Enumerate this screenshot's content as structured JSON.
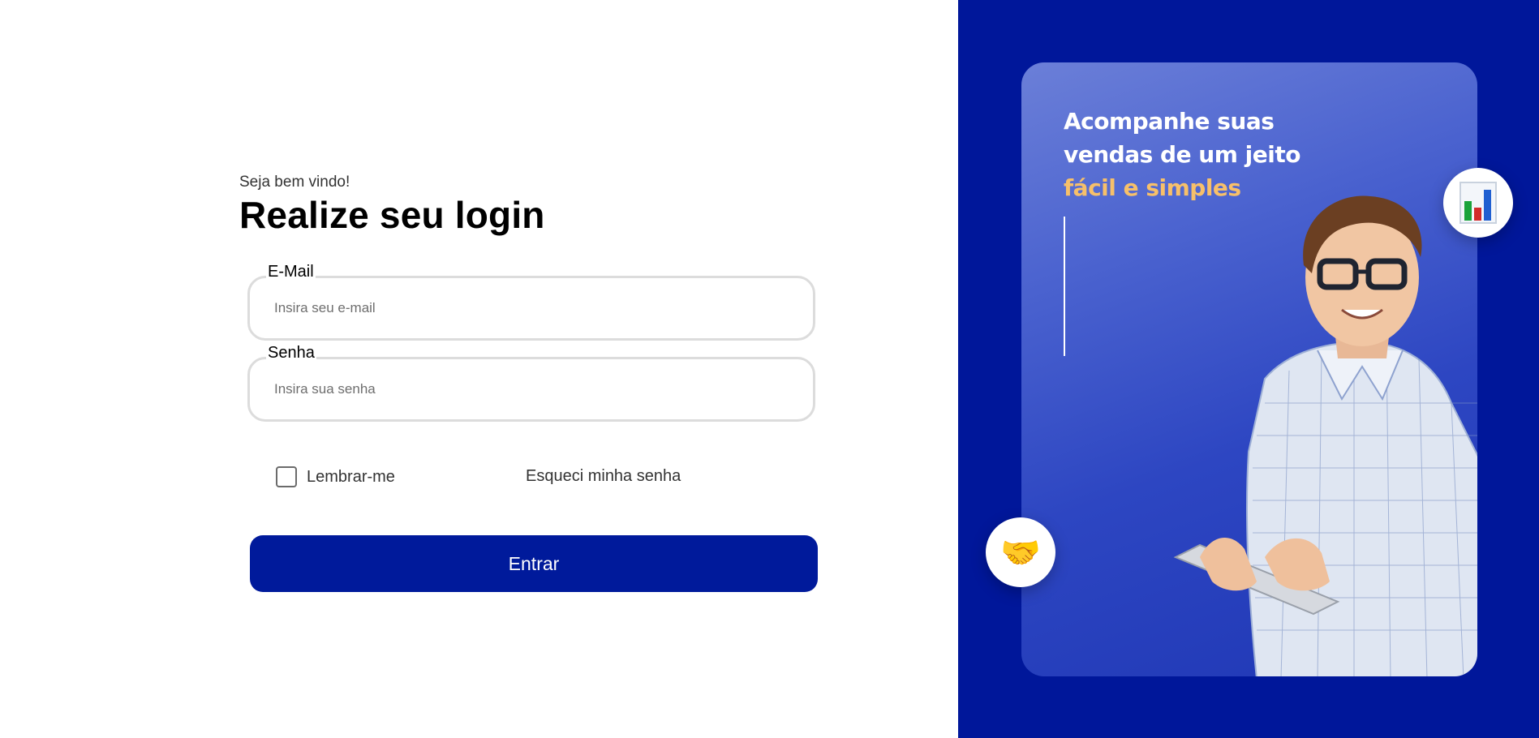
{
  "login": {
    "welcome": "Seja bem vindo!",
    "title": "Realize seu login",
    "email_label": "E-Mail",
    "email_placeholder": "Insira seu e-mail",
    "password_label": "Senha",
    "password_placeholder": "Insira sua senha",
    "remember_label": "Lembrar-me",
    "remember_checked": false,
    "forgot_label": "Esqueci minha senha",
    "submit_label": "Entrar"
  },
  "promo": {
    "headline_line1": "Acompanhe suas",
    "headline_line2": "vendas de um jeito",
    "headline_highlight": "fácil e simples",
    "chart_icon": "bar-chart-icon",
    "handshake_icon": "handshake-icon",
    "handshake_glyph": "🤝"
  },
  "colors": {
    "primary": "#001a9b",
    "panel_bg": "#00179a",
    "highlight": "#f7c06a",
    "chart_bars": [
      "#1aa33a",
      "#d22b2b",
      "#1f5fd1"
    ]
  }
}
